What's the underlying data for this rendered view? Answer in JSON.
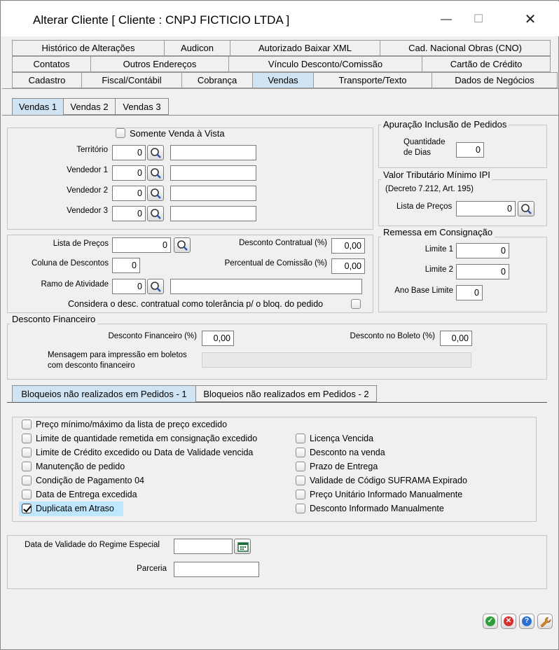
{
  "window": {
    "title": "Alterar Cliente [ Cliente : CNPJ FICTICIO LTDA ]",
    "minimize_glyph": "—",
    "maximize_glyph": "☐",
    "close_glyph": "✕"
  },
  "tabs": {
    "row1": [
      "Histórico de Alterações",
      "Audicon",
      "Autorizado Baixar XML",
      "Cad. Nacional Obras (CNO)"
    ],
    "row2": [
      "Contatos",
      "Outros Endereços",
      "Vínculo Desconto/Comissão",
      "Cartão de Crédito"
    ],
    "row3": [
      "Cadastro",
      "Fiscal/Contábil",
      "Cobrança",
      "Vendas",
      "Transporte/Texto",
      "Dados de Negócios"
    ],
    "active": "Vendas"
  },
  "subtabs": [
    "Vendas 1",
    "Vendas 2",
    "Vendas 3"
  ],
  "vendas": {
    "somente_vista": "Somente Venda à Vista",
    "fields": [
      {
        "label": "Território",
        "value": "0",
        "desc": ""
      },
      {
        "label": "Vendedor 1",
        "value": "0",
        "desc": ""
      },
      {
        "label": "Vendedor 2",
        "value": "0",
        "desc": ""
      },
      {
        "label": "Vendedor 3",
        "value": "0",
        "desc": ""
      }
    ]
  },
  "apuracao": {
    "title": "Apuração Inclusão de Pedidos",
    "qtd_label_1": "Quantidade",
    "qtd_label_2": "de Dias",
    "qtd_value": "0"
  },
  "ipi": {
    "title": "Valor Tributário Mínimo IPI",
    "decreto": "(Decreto 7.212, Art. 195)",
    "lista_label": "Lista de Preços",
    "lista_value": "0"
  },
  "precos": {
    "lista_label": "Lista de Preços",
    "lista_value": "0",
    "desc_contratual_label": "Desconto Contratual (%)",
    "desc_contratual_value": "0,00",
    "coluna_label": "Coluna de Descontos",
    "coluna_value": "0",
    "comissao_label": "Percentual de Comissão (%)",
    "comissao_value": "0,00",
    "ramo_label": "Ramo de Atividade",
    "ramo_value": "0",
    "ramo_desc": "",
    "considera_label": "Considera o desc. contratual como tolerância p/ o bloq. do pedido"
  },
  "consignacao": {
    "title": "Remessa em Consignação",
    "limite1_label": "Limite 1",
    "limite1_value": "0",
    "limite2_label": "Limite 2",
    "limite2_value": "0",
    "ano_label": "Ano Base Limite",
    "ano_value": "0"
  },
  "financeiro": {
    "title": "Desconto Financeiro",
    "desc_fin_label": "Desconto Financeiro (%)",
    "desc_fin_value": "0,00",
    "desc_boleto_label": "Desconto no Boleto  (%)",
    "desc_boleto_value": "0,00",
    "msg_label_1": "Mensagem para impressão em boletos",
    "msg_label_2": "com desconto financeiro",
    "msg_value": ""
  },
  "bloqueios_tabs": [
    "Bloqueios não realizados em Pedidos - 1",
    "Bloqueios não realizados em Pedidos - 2"
  ],
  "bloqueios": {
    "left": [
      {
        "label": "Preço mínimo/máximo da lista de preço excedido",
        "checked": false
      },
      {
        "label": "Limite de quantidade remetida em consignação excedido",
        "checked": false
      },
      {
        "label": "Limite de Crédito excedido ou Data de Validade vencida",
        "checked": false
      },
      {
        "label": "Manutenção de pedido",
        "checked": false
      },
      {
        "label": "Condição de Pagamento 04",
        "checked": false
      },
      {
        "label": "Data de Entrega excedida",
        "checked": false
      },
      {
        "label": "Duplicata em Atraso",
        "checked": true
      }
    ],
    "right": [
      {
        "label": "Licença Vencida",
        "checked": false
      },
      {
        "label": "Desconto na venda",
        "checked": false
      },
      {
        "label": "Prazo de Entrega",
        "checked": false
      },
      {
        "label": "Validade de Código SUFRAMA Expirado",
        "checked": false
      },
      {
        "label": "Preço Unitário Informado Manualmente",
        "checked": false
      },
      {
        "label": "Desconto Informado Manualmente",
        "checked": false
      }
    ]
  },
  "regime": {
    "data_label": "Data de Validade do Regime Especial",
    "data_value": "",
    "parceria_label": "Parceria",
    "parceria_value": ""
  },
  "footer_buttons": [
    {
      "name": "confirm-icon",
      "glyph": "✓",
      "color": "#2e9e3a"
    },
    {
      "name": "cancel-icon",
      "glyph": "✕",
      "color": "#d33030"
    },
    {
      "name": "help-icon",
      "glyph": "?",
      "color": "#2a6fd1"
    },
    {
      "name": "wrench-icon",
      "glyph": "",
      "color": "#e08a1e"
    }
  ]
}
